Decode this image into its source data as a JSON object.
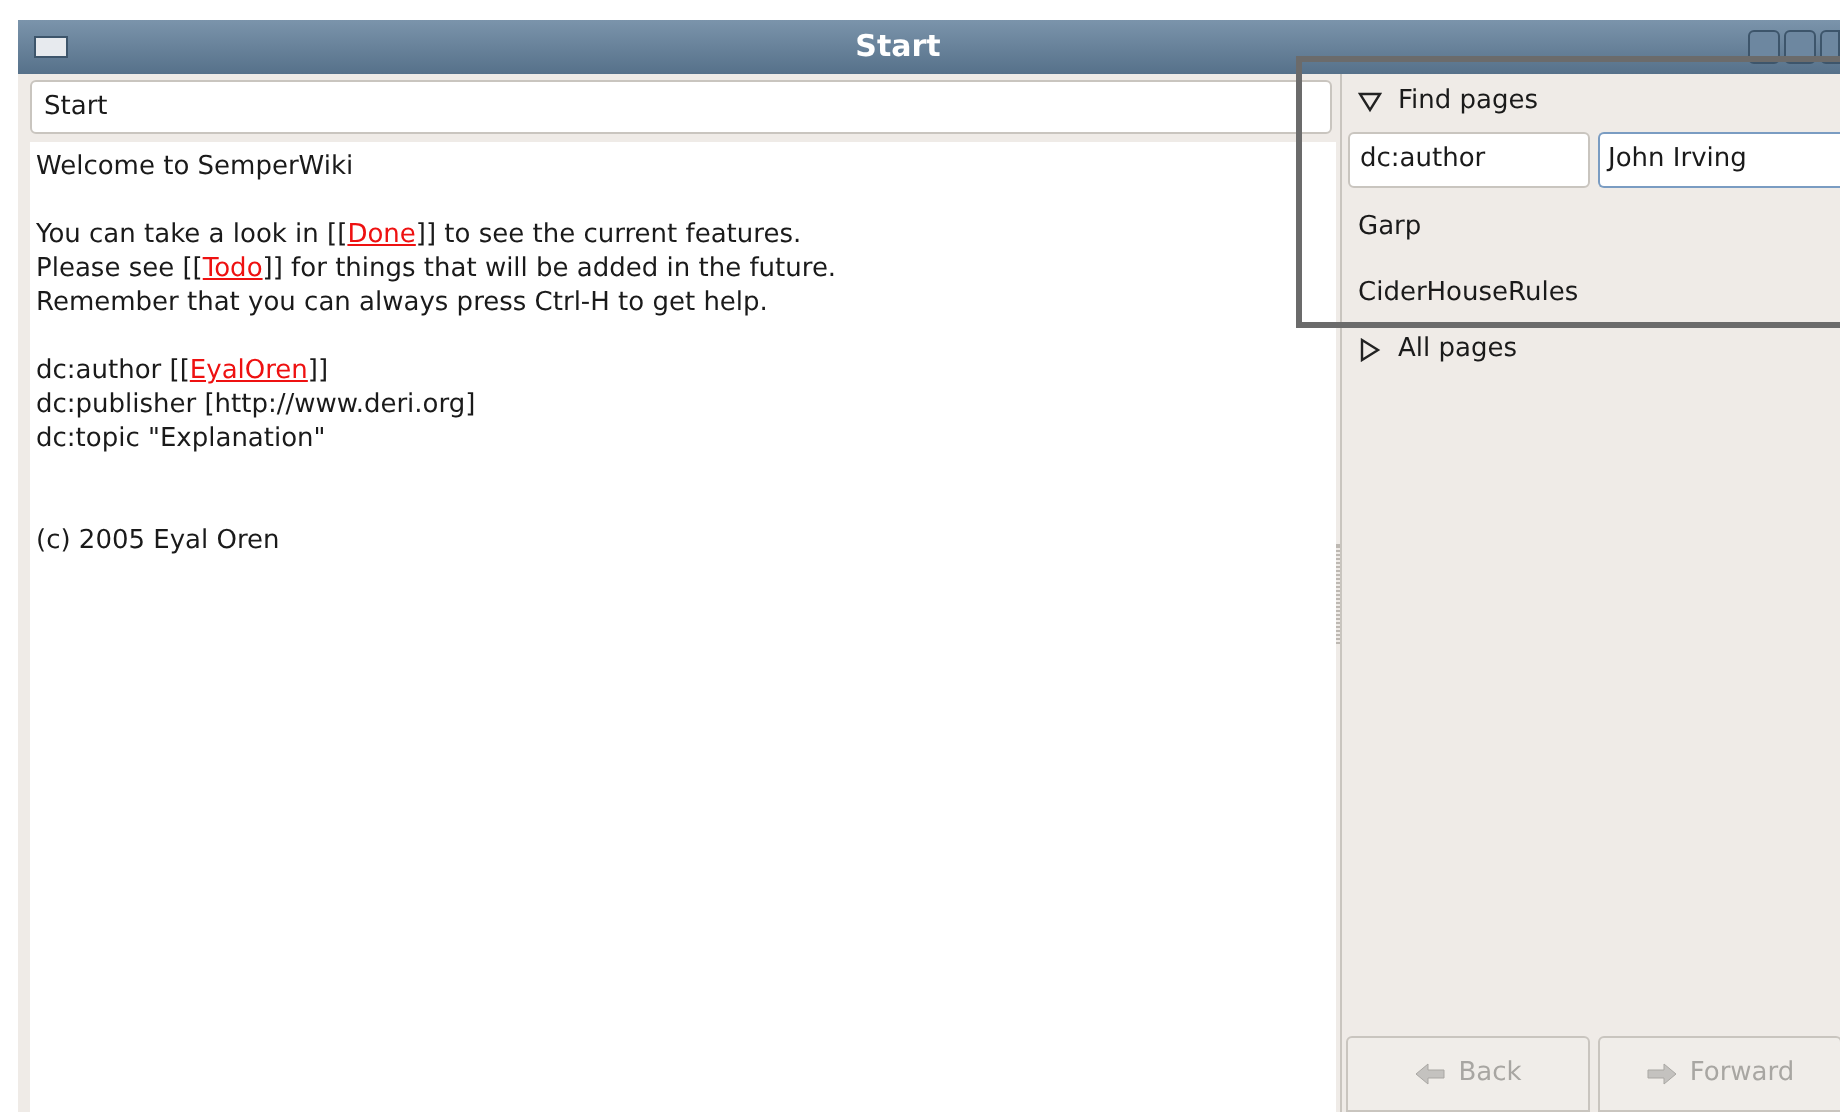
{
  "window": {
    "title": "Start"
  },
  "page_title": {
    "value": "Start"
  },
  "content": [
    {
      "kind": "paragraph",
      "lines": [
        [
          {
            "kind": "text",
            "text": "Welcome to SemperWiki"
          }
        ]
      ]
    },
    {
      "kind": "paragraph",
      "lines": [
        [
          {
            "kind": "text",
            "text": "You can take a look in [["
          },
          {
            "kind": "link",
            "text": "Done"
          },
          {
            "kind": "text",
            "text": "]] to see the current features."
          }
        ],
        [
          {
            "kind": "text",
            "text": "Please see [["
          },
          {
            "kind": "link",
            "text": "Todo"
          },
          {
            "kind": "text",
            "text": "]] for things that will be added in the future."
          }
        ],
        [
          {
            "kind": "text",
            "text": "Remember that you can always press Ctrl-H to get help."
          }
        ]
      ]
    },
    {
      "kind": "paragraph",
      "lines": [
        [
          {
            "kind": "text",
            "text": "dc:author [["
          },
          {
            "kind": "link",
            "text": "EyalOren"
          },
          {
            "kind": "text",
            "text": "]]"
          }
        ],
        [
          {
            "kind": "text",
            "text": "dc:publisher [http://www.deri.org]"
          }
        ],
        [
          {
            "kind": "text",
            "text": "dc:topic \"Explanation\""
          }
        ]
      ]
    },
    {
      "kind": "footer",
      "lines": [
        [
          {
            "kind": "text",
            "text": "(c) 2005 Eyal Oren"
          }
        ]
      ]
    }
  ],
  "sidebar": {
    "sections": [
      {
        "label": "Find pages",
        "expanded": true,
        "query": {
          "field": "dc:author",
          "value": "John Irving"
        },
        "results": [
          "Garp",
          "CiderHouseRules"
        ]
      },
      {
        "label": "All pages",
        "expanded": false
      }
    ],
    "buttons": [
      {
        "label": "Back",
        "disabled": true,
        "kind": "back"
      },
      {
        "label": "Forward",
        "disabled": true,
        "kind": "forward"
      }
    ]
  }
}
